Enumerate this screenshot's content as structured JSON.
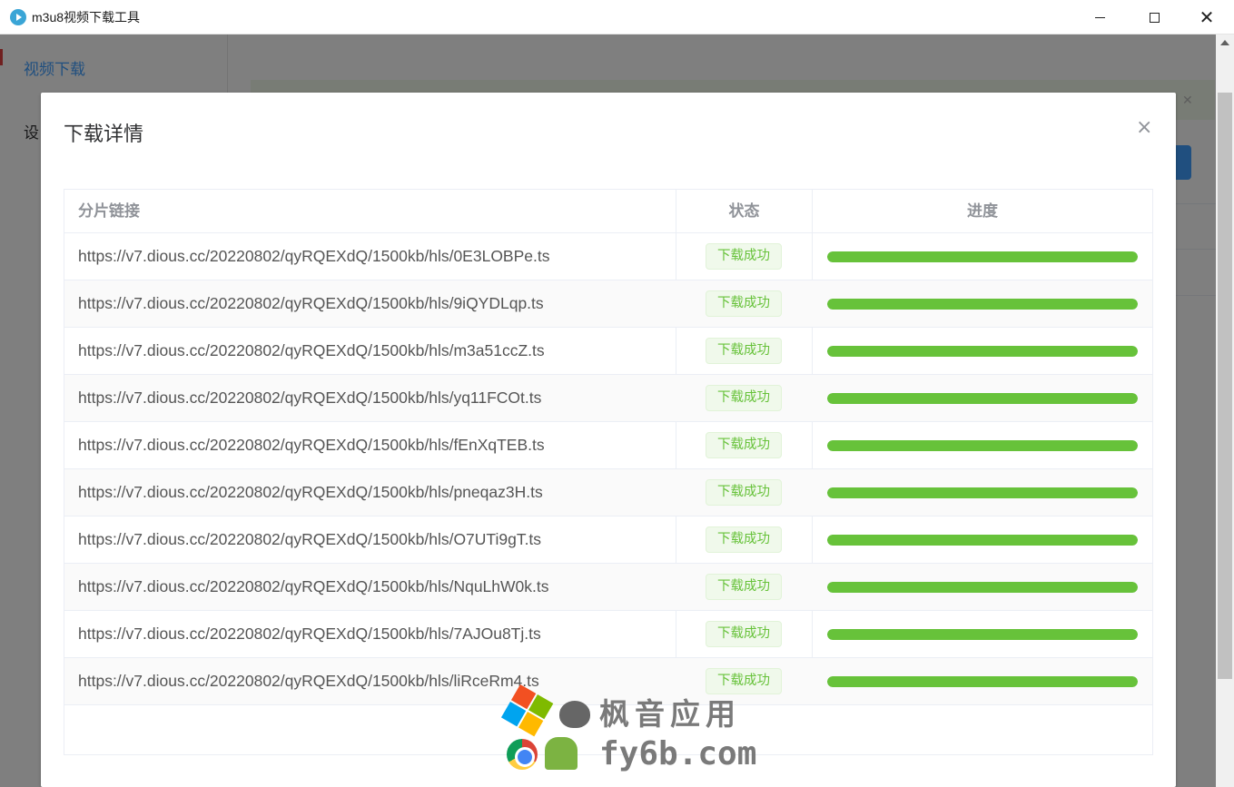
{
  "window": {
    "title": "m3u8视频下载工具",
    "controls": {
      "minimize": "minimize",
      "maximize": "maximize",
      "close": "close"
    }
  },
  "sidebar": {
    "items": [
      {
        "label": "视频下载"
      },
      {
        "label": "设"
      }
    ]
  },
  "dialog": {
    "title": "下载详情",
    "close_glyph": "×",
    "columns": {
      "url": "分片链接",
      "status": "状态",
      "progress": "进度"
    },
    "rows": [
      {
        "url": "https://v7.dious.cc/20220802/qyRQEXdQ/1500kb/hls/0E3LOBPe.ts",
        "status": "下载成功",
        "progress": 100
      },
      {
        "url": "https://v7.dious.cc/20220802/qyRQEXdQ/1500kb/hls/9iQYDLqp.ts",
        "status": "下载成功",
        "progress": 100
      },
      {
        "url": "https://v7.dious.cc/20220802/qyRQEXdQ/1500kb/hls/m3a51ccZ.ts",
        "status": "下载成功",
        "progress": 100
      },
      {
        "url": "https://v7.dious.cc/20220802/qyRQEXdQ/1500kb/hls/yq11FCOt.ts",
        "status": "下载成功",
        "progress": 100
      },
      {
        "url": "https://v7.dious.cc/20220802/qyRQEXdQ/1500kb/hls/fEnXqTEB.ts",
        "status": "下载成功",
        "progress": 100
      },
      {
        "url": "https://v7.dious.cc/20220802/qyRQEXdQ/1500kb/hls/pneqaz3H.ts",
        "status": "下载成功",
        "progress": 100
      },
      {
        "url": "https://v7.dious.cc/20220802/qyRQEXdQ/1500kb/hls/O7UTi9gT.ts",
        "status": "下载成功",
        "progress": 100
      },
      {
        "url": "https://v7.dious.cc/20220802/qyRQEXdQ/1500kb/hls/NquLhW0k.ts",
        "status": "下载成功",
        "progress": 100
      },
      {
        "url": "https://v7.dious.cc/20220802/qyRQEXdQ/1500kb/hls/7AJOu8Tj.ts",
        "status": "下载成功",
        "progress": 100
      },
      {
        "url": "https://v7.dious.cc/20220802/qyRQEXdQ/1500kb/hls/liRceRm4.ts",
        "status": "下载成功",
        "progress": 100
      }
    ]
  },
  "watermark": {
    "cn": "枫音应用",
    "en": "fy6b.com"
  },
  "colors": {
    "accent": "#409eff",
    "success": "#67c23a",
    "success_bg": "#f0f9eb"
  }
}
